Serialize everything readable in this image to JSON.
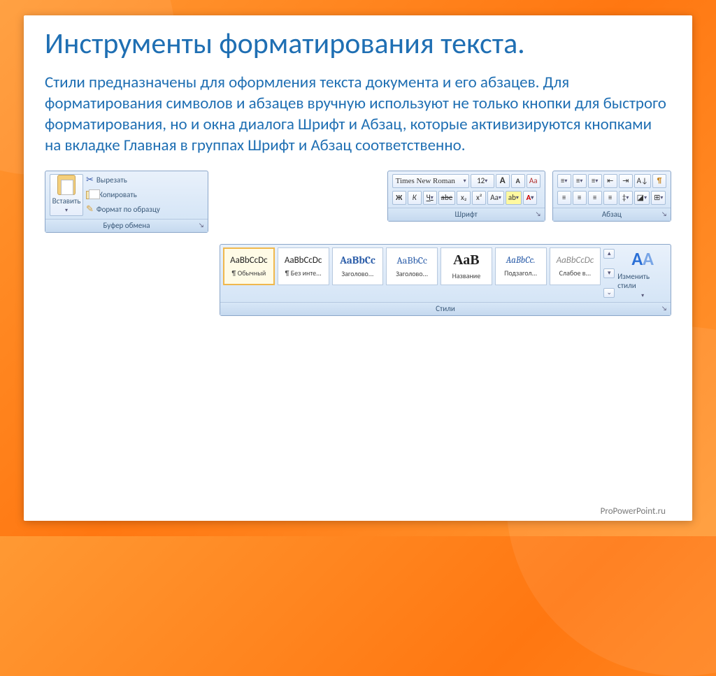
{
  "slide": {
    "title": "Инструменты форматирования текста.",
    "body": "Стили предназначены для оформления текста документа и его абзацев. Для форматирования символов и абзацев вручную используют не только кнопки для быстрого форматирования, но и окна диалога Шрифт и Абзац, которые активизируются кнопками на вкладке Главная в группах Шрифт и Абзац соответственно.",
    "watermark": "ProPowerPoint.ru"
  },
  "clipboard": {
    "paste": "Вставить",
    "cut": "Вырезать",
    "copy": "Копировать",
    "format_painter": "Формат по образцу",
    "group_label": "Буфер обмена"
  },
  "font": {
    "name": "Times New Roman",
    "size": "12",
    "grow": "A",
    "shrink": "A",
    "clear": "Aa",
    "bold": "Ж",
    "italic": "К",
    "underline": "Ч",
    "strike": "abe",
    "sub": "x₂",
    "sup": "x²",
    "case": "Aa",
    "highlight": "ab",
    "color": "A",
    "group_label": "Шрифт"
  },
  "paragraph": {
    "bullets": "≡",
    "numbers": "≡",
    "multilevel": "≡",
    "dec_indent": "⇤",
    "inc_indent": "⇥",
    "sort": "A↓",
    "pilcrow": "¶",
    "align_l": "≡",
    "align_c": "≡",
    "align_r": "≡",
    "align_j": "≡",
    "linesp": "‡",
    "shading": "◪",
    "borders": "⊞",
    "group_label": "Абзац"
  },
  "styles": {
    "group_label": "Стили",
    "change_styles": "Изменить стили",
    "items": [
      {
        "sample": "AaBbCcDc",
        "label": "¶ Обычный",
        "style": "font-family:Calibri;color:#222"
      },
      {
        "sample": "AaBbCcDc",
        "label": "¶ Без инте...",
        "style": "font-family:Calibri;color:#222"
      },
      {
        "sample": "AaBbCc",
        "label": "Заголово...",
        "style": "font-family:Cambria,serif;color:#2a5ca8;font-weight:bold;font-size:15px"
      },
      {
        "sample": "AaBbCc",
        "label": "Заголово...",
        "style": "font-family:Cambria,serif;color:#2a5ca8;font-size:14px"
      },
      {
        "sample": "АаВ",
        "label": "Название",
        "style": "font-family:Cambria,serif;color:#222;font-size:20px;font-weight:bold"
      },
      {
        "sample": "AaBbCc.",
        "label": "Подзагол...",
        "style": "font-family:Cambria,serif;color:#2a5ca8;font-style:italic"
      },
      {
        "sample": "AaBbCcDc",
        "label": "Слабое в...",
        "style": "font-family:Calibri;color:#888;font-style:italic"
      }
    ]
  }
}
